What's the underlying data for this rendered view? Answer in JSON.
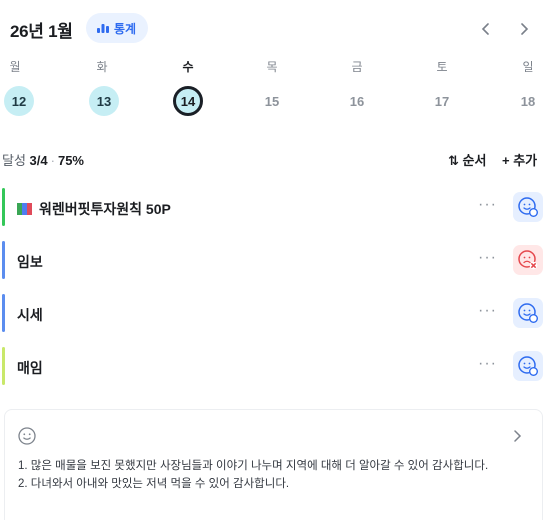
{
  "header": {
    "month_title": "26년 1월",
    "stats_label": "통계",
    "stats_icon": "bar-chart-icon",
    "prev_icon": "chevron-left-icon",
    "next_icon": "chevron-right-icon"
  },
  "week": {
    "weekdays": [
      "월",
      "화",
      "수",
      "목",
      "금",
      "토",
      "일"
    ],
    "active_weekday_index": 2,
    "days": [
      {
        "num": "12",
        "state": "done"
      },
      {
        "num": "13",
        "state": "done"
      },
      {
        "num": "14",
        "state": "today"
      },
      {
        "num": "15",
        "state": "none"
      },
      {
        "num": "16",
        "state": "none"
      },
      {
        "num": "17",
        "state": "none"
      },
      {
        "num": "18",
        "state": "none"
      }
    ]
  },
  "progress": {
    "label": "달성",
    "count": "3/4",
    "percent": "75%",
    "sort_label": "⇅ 순서",
    "add_label": "+ 추가"
  },
  "habits": [
    {
      "title": "워렌버핏투자원칙 50P",
      "color": "#34c759",
      "has_book_icon": true,
      "status": "good"
    },
    {
      "title": "임보",
      "color": "#5b8def",
      "has_book_icon": false,
      "status": "bad"
    },
    {
      "title": "시세",
      "color": "#5b8def",
      "has_book_icon": false,
      "status": "good"
    },
    {
      "title": "매임",
      "color": "#c9e86a",
      "has_book_icon": false,
      "status": "good"
    }
  ],
  "more_label": "···",
  "journal": {
    "line1": "1. 많은 매물을 보진 못했지만 사장님들과 이야기 나누며 지역에 대해 더 알아갈 수 있어 감사합니다.",
    "line2": "2. 다녀와서 아내와 맛있는 저녁 먹을 수 있어 감사합니다."
  },
  "colors": {
    "accent_blue": "#2e6bf0",
    "done_day_bg": "#c6eef4",
    "status_good_bg": "#e6efff",
    "status_bad_bg": "#ffe7e7",
    "status_bad_fg": "#e5484d"
  }
}
